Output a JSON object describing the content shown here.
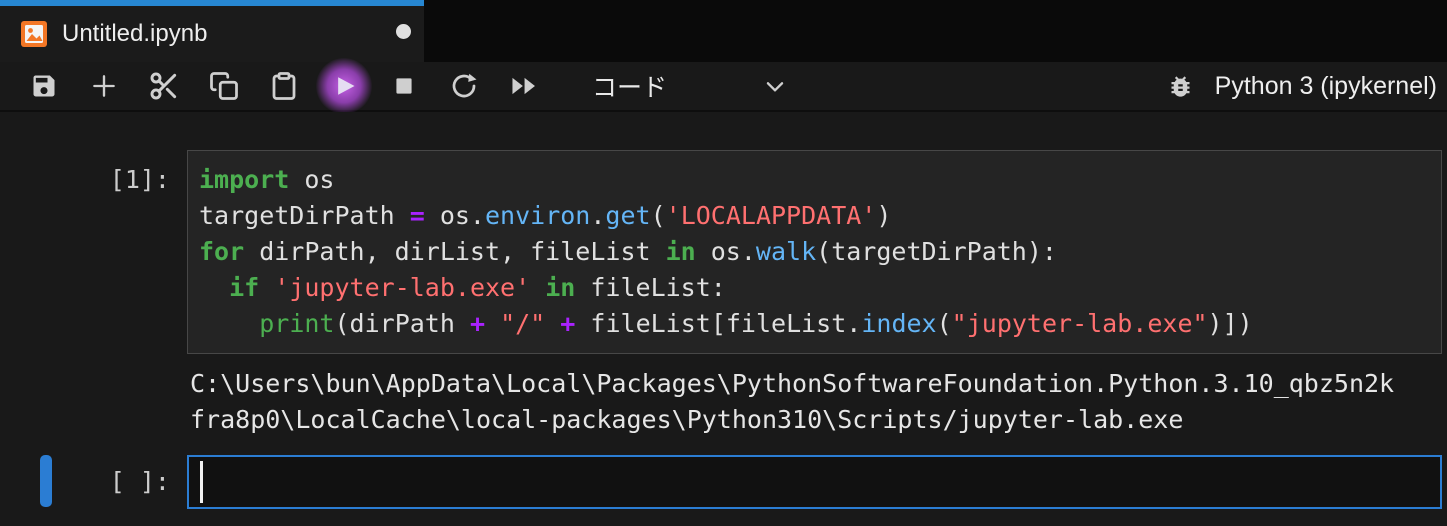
{
  "tab": {
    "title": "Untitled.ipynb",
    "dirty": true
  },
  "toolbar": {
    "buttons": [
      "save",
      "insert-cell-below",
      "cut-cells",
      "copy-cells",
      "paste-cells",
      "run",
      "interrupt-kernel",
      "restart-kernel",
      "restart-and-run-all"
    ],
    "cell_type_label": "コード",
    "kernel_label": "Python 3 (ipykernel)"
  },
  "notebook": {
    "cells": [
      {
        "prompt": "[1]:",
        "language": "python",
        "source_tokens": [
          [
            [
              "import",
              "kw"
            ],
            [
              " os",
              "pl"
            ]
          ],
          [
            [
              "targetDirPath ",
              "pl"
            ],
            [
              "=",
              "op"
            ],
            [
              " os.",
              "pl"
            ],
            [
              "environ",
              "prop"
            ],
            [
              ".",
              "pl"
            ],
            [
              "get",
              "prop"
            ],
            [
              "(",
              "pl"
            ],
            [
              "'LOCALAPPDATA'",
              "str"
            ],
            [
              ")",
              "pl"
            ]
          ],
          [
            [
              "for",
              "kw"
            ],
            [
              " dirPath, dirList, fileList ",
              "pl"
            ],
            [
              "in",
              "kw"
            ],
            [
              " os.",
              "pl"
            ],
            [
              "walk",
              "prop"
            ],
            [
              "(targetDirPath):",
              "pl"
            ]
          ],
          [
            [
              "  ",
              "pl"
            ],
            [
              "if",
              "kw"
            ],
            [
              " ",
              "pl"
            ],
            [
              "'jupyter-lab.exe'",
              "str"
            ],
            [
              " ",
              "pl"
            ],
            [
              "in",
              "kw"
            ],
            [
              " fileList:",
              "pl"
            ]
          ],
          [
            [
              "    ",
              "pl"
            ],
            [
              "print",
              "bi"
            ],
            [
              "(dirPath ",
              "pl"
            ],
            [
              "+",
              "op"
            ],
            [
              " ",
              "pl"
            ],
            [
              "\"/\"",
              "str"
            ],
            [
              " ",
              "pl"
            ],
            [
              "+",
              "op"
            ],
            [
              " fileList[fileList.",
              "pl"
            ],
            [
              "index",
              "prop"
            ],
            [
              "(",
              "pl"
            ],
            [
              "\"jupyter-lab.exe\"",
              "str"
            ],
            [
              ")])",
              "pl"
            ]
          ]
        ],
        "outputs": [
          "C:\\Users\\bun\\AppData\\Local\\Packages\\PythonSoftwareFoundation.Python.3.10_qbz5n2k",
          "fra8p0\\LocalCache\\local-packages\\Python310\\Scripts/jupyter-lab.exe"
        ]
      },
      {
        "prompt": "[ ]:",
        "active": true,
        "source_tokens": [],
        "outputs": []
      }
    ]
  },
  "icons": {
    "notebook-icon": "orange picture/notebook glyph",
    "save-icon": "floppy disk",
    "plus-icon": "plus sign",
    "scissors-icon": "scissors (cut)",
    "copy-icon": "two overlapping pages",
    "clipboard-icon": "clipboard (paste)",
    "play-icon": "filled right triangle (run)",
    "stop-icon": "filled square (interrupt kernel)",
    "restart-icon": "circular arrow (restart kernel)",
    "fast-forward-icon": "double triangle (restart and run all)",
    "chevron-down-icon": "dropdown caret",
    "bug-icon": "debugger bug",
    "unsaved-dot": "filled circle (unsaved changes)"
  },
  "colors": {
    "accent_blue": "#2b7dd3",
    "tab_accent": "#2787d2",
    "cell_border": "#474747",
    "keyword": "#4caf50",
    "operator": "#aa22ff",
    "string": "#ff7070",
    "property": "#64b5f6",
    "builtin": "#4caf50",
    "run_glow": "#c561e6",
    "jupyter_orange": "#f37726"
  }
}
